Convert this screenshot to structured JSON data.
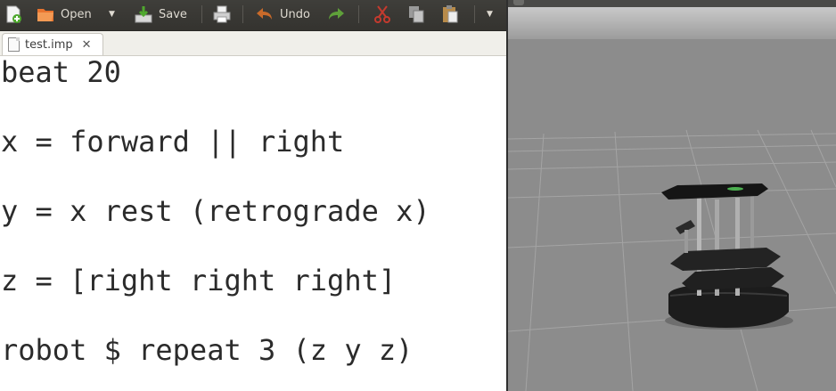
{
  "toolbar": {
    "open_label": "Open",
    "save_label": "Save",
    "undo_label": "Undo"
  },
  "tab": {
    "filename": "test.imp",
    "close_glyph": "✕"
  },
  "code_lines": [
    "beat 20",
    "x = forward || right",
    "y = x rest (retrograde x)",
    "z = [right right right]",
    "robot $ repeat 3 (z y z)"
  ],
  "colors": {
    "toolbar_bg": "#3c3b37",
    "editor_bg": "#ffffff",
    "ground": "#8f8f8f",
    "robot_body": "#1c1c1c",
    "led": "#4caf50"
  }
}
